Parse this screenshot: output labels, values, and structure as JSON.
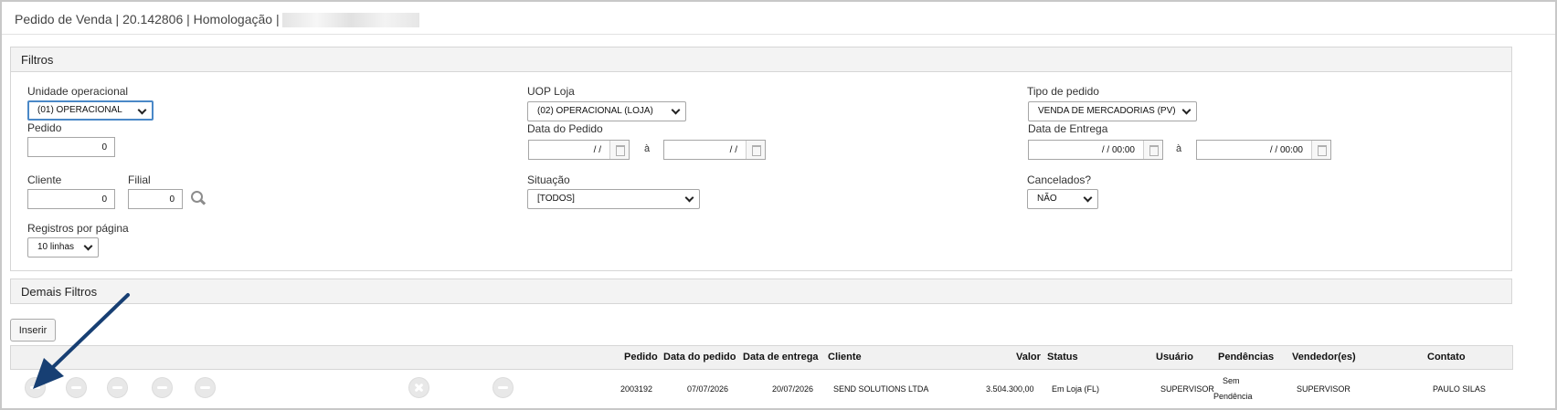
{
  "window": {
    "title": "Pedido de Venda | 20.142806 | Homologação |"
  },
  "filters": {
    "header": "Filtros",
    "unidade_operacional": {
      "label": "Unidade operacional",
      "value": "(01) OPERACIONAL"
    },
    "uop_loja": {
      "label": "UOP Loja",
      "value": "(02) OPERACIONAL (LOJA)"
    },
    "tipo_pedido": {
      "label": "Tipo de pedido",
      "value": "VENDA DE MERCADORIAS (PV)"
    },
    "pedido": {
      "label": "Pedido",
      "value": "0"
    },
    "data_pedido": {
      "label": "Data do Pedido",
      "from": "/ /",
      "sep": "à",
      "to": "/ /"
    },
    "data_entrega": {
      "label": "Data de Entrega",
      "from": "/ /     00:00",
      "sep": "à",
      "to": "/ /     00:00"
    },
    "cliente": {
      "label": "Cliente",
      "value": "0"
    },
    "filial": {
      "label": "Filial",
      "value": "0"
    },
    "situacao": {
      "label": "Situação",
      "value": "[TODOS]"
    },
    "cancelados": {
      "label": "Cancelados?",
      "value": "NÃO"
    },
    "registros": {
      "label": "Registros por página",
      "value": "10 linhas"
    }
  },
  "demais_filtros": {
    "header": "Demais Filtros"
  },
  "toolbar": {
    "inserir_label": "Inserir"
  },
  "grid": {
    "columns": [
      "Pedido",
      "Data do pedido",
      "Data de entrega",
      "Cliente",
      "Valor",
      "Status",
      "Usuário",
      "Pendências",
      "Vendedor(es)",
      "Contato"
    ],
    "rows": [
      {
        "pedido": "2003192",
        "data_pedido": "07/07/2026",
        "data_entrega": "20/07/2026",
        "cliente": "SEND SOLUTIONS LTDA",
        "valor": "3.504.300,00",
        "status": "Em Loja (FL)",
        "usuario": "SUPERVISOR",
        "pendencias_1": "Sem",
        "pendencias_2": "Pendência",
        "vendedor": "SUPERVISOR",
        "contato": "PAULO SILAS"
      }
    ]
  },
  "colors": {
    "arrow": "#173f73",
    "focus_border": "#4a88c7",
    "panel_header_bg": "#f3f3f3"
  },
  "icons": [
    "search-icon",
    "calendar-icon",
    "edit-icon",
    "view-icon",
    "history-icon",
    "cancel-icon",
    "pointer-arrow"
  ]
}
